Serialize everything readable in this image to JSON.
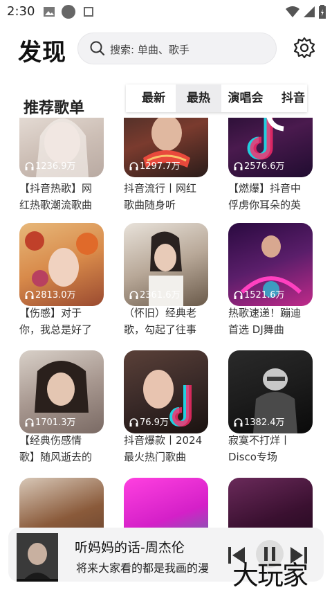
{
  "status_bar": {
    "time": "2:30"
  },
  "header": {
    "title": "发现",
    "search_placeholder": "搜索: 单曲、歌手"
  },
  "section": {
    "title": "推荐歌单"
  },
  "tabs": [
    {
      "label": "最新",
      "active": false
    },
    {
      "label": "最热",
      "active": true
    },
    {
      "label": "演唱会",
      "active": false
    },
    {
      "label": "抖音",
      "active": false
    }
  ],
  "playlists": [
    {
      "plays": "1236.9万",
      "line1": "【抖音热歌】网",
      "line2": "红热歌潮流歌曲",
      "color": "#d9cfc8"
    },
    {
      "plays": "1297.7万",
      "line1": "抖音流行丨网红",
      "line2": "歌曲随身听",
      "color": "#7a3b2e"
    },
    {
      "plays": "2576.6万",
      "line1": "【燃爆】抖音中",
      "line2": "俘虏你耳朵的英",
      "color": "#4a1a4e"
    },
    {
      "plays": "2813.0万",
      "line1": "【伤感】对于",
      "line2": "你，我总是好了",
      "color": "#d88a4a"
    },
    {
      "plays": "2361.6万",
      "line1": "（怀旧）经典老",
      "line2": "歌，勾起了往事",
      "color": "#8a7a6a"
    },
    {
      "plays": "1521.6万",
      "line1": "热歌速递！蹦迪",
      "line2": "首选 DJ舞曲",
      "color": "#5a1e6a"
    },
    {
      "plays": "1701.3万",
      "line1": "【经典伤感情",
      "line2": "歌】随风逝去的",
      "color": "#b8aaa2"
    },
    {
      "plays": "76.9万",
      "line1": "抖音爆款丨2024",
      "line2": "最火热门歌曲",
      "color": "#3a2a28"
    },
    {
      "plays": "1382.4万",
      "line1": "寂寞不打烊丨",
      "line2": "Disco专场",
      "color": "#1c1c1c"
    },
    {
      "plays": "",
      "line1": "",
      "line2": "",
      "color": "#5a3a2a"
    },
    {
      "plays": "",
      "line1": "",
      "line2": "",
      "color": "#d420c8"
    },
    {
      "plays": "",
      "line1": "",
      "line2": "",
      "color": "#3a1030"
    }
  ],
  "player": {
    "title": "听妈妈的话-周杰伦",
    "lyric": "将来大家看的都是我画的漫"
  },
  "watermark": "大玩家",
  "colors": {
    "accent_cyan": "#20d0e0",
    "accent_pink": "#ff2a6a"
  }
}
